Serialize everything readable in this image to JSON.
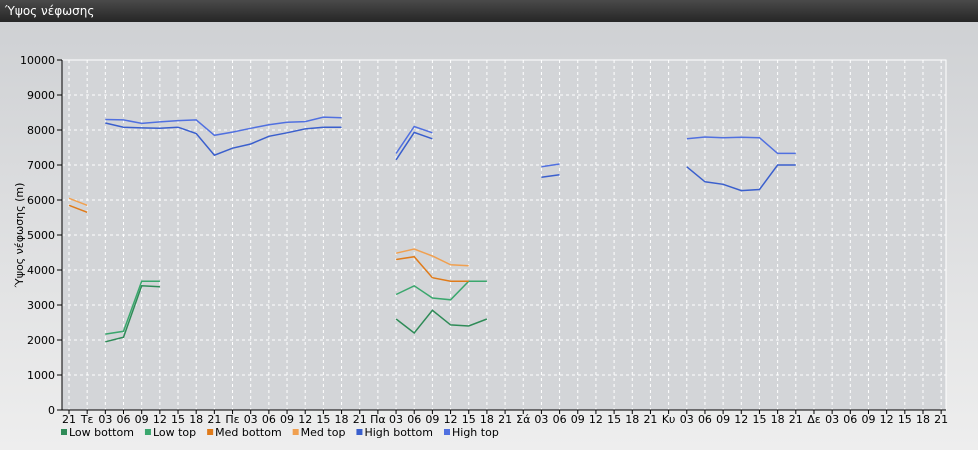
{
  "window": {
    "title": "Ύψος νέφωσης"
  },
  "chart_data": {
    "type": "line",
    "title": "",
    "ylabel": "Ύψος νέφωσης (m)",
    "xlabel": "",
    "ylim": [
      0,
      10000
    ],
    "yticks": [
      0,
      1000,
      2000,
      3000,
      4000,
      5000,
      6000,
      7000,
      8000,
      9000,
      10000
    ],
    "x_tick_labels": [
      "21",
      "Τε",
      "03",
      "06",
      "09",
      "12",
      "15",
      "18",
      "21",
      "Πε",
      "03",
      "06",
      "09",
      "12",
      "15",
      "18",
      "21",
      "Πα",
      "03",
      "06",
      "09",
      "12",
      "15",
      "18",
      "21",
      "Σά",
      "03",
      "06",
      "09",
      "12",
      "15",
      "18",
      "21",
      "Κυ",
      "03",
      "06",
      "09",
      "12",
      "15",
      "18",
      "21",
      "Δε",
      "03",
      "06",
      "09",
      "12",
      "15",
      "18",
      "21"
    ],
    "grid": true,
    "legend": "bottom-left",
    "series": [
      {
        "name": "Low bottom",
        "color": "#2e8b57",
        "segments": [
          [
            [
              2,
              1950
            ],
            [
              3,
              2080
            ],
            [
              4,
              3550
            ],
            [
              5,
              3520
            ]
          ],
          [
            [
              18,
              2600
            ],
            [
              19,
              2200
            ],
            [
              20,
              2850
            ],
            [
              21,
              2430
            ],
            [
              22,
              2400
            ],
            [
              23,
              2600
            ]
          ]
        ]
      },
      {
        "name": "Low top",
        "color": "#3aa76d",
        "segments": [
          [
            [
              2,
              2170
            ],
            [
              3,
              2250
            ],
            [
              4,
              3680
            ],
            [
              5,
              3680
            ]
          ],
          [
            [
              18,
              3300
            ],
            [
              19,
              3550
            ],
            [
              20,
              3200
            ],
            [
              21,
              3150
            ],
            [
              22,
              3680
            ],
            [
              23,
              3680
            ]
          ]
        ]
      },
      {
        "name": "Med bottom",
        "color": "#e07b1a",
        "segments": [
          [
            [
              0,
              5850
            ],
            [
              1,
              5650
            ]
          ],
          [
            [
              18,
              4300
            ],
            [
              19,
              4380
            ],
            [
              20,
              3780
            ],
            [
              21,
              3680
            ],
            [
              22,
              3680
            ]
          ]
        ]
      },
      {
        "name": "Med top",
        "color": "#f0a050",
        "segments": [
          [
            [
              0,
              6050
            ],
            [
              1,
              5850
            ]
          ],
          [
            [
              18,
              4480
            ],
            [
              19,
              4600
            ],
            [
              20,
              4400
            ],
            [
              21,
              4150
            ],
            [
              22,
              4120
            ]
          ]
        ]
      },
      {
        "name": "High bottom",
        "color": "#3a5fcd",
        "segments": [
          [
            [
              2,
              8200
            ],
            [
              3,
              8080
            ],
            [
              4,
              8060
            ],
            [
              5,
              8050
            ],
            [
              6,
              8080
            ],
            [
              7,
              7900
            ],
            [
              8,
              7280
            ],
            [
              9,
              7480
            ],
            [
              10,
              7600
            ],
            [
              11,
              7820
            ],
            [
              12,
              7920
            ],
            [
              13,
              8030
            ],
            [
              14,
              8080
            ],
            [
              15,
              8080
            ]
          ],
          [
            [
              18,
              7150
            ],
            [
              19,
              7930
            ],
            [
              20,
              7750
            ]
          ],
          [
            [
              26,
              6650
            ],
            [
              27,
              6720
            ]
          ],
          [
            [
              34,
              6950
            ],
            [
              35,
              6520
            ],
            [
              36,
              6450
            ],
            [
              37,
              6270
            ],
            [
              38,
              6300
            ],
            [
              39,
              7000
            ],
            [
              40,
              7000
            ]
          ]
        ]
      },
      {
        "name": "High top",
        "color": "#5070e0",
        "segments": [
          [
            [
              2,
              8300
            ],
            [
              3,
              8290
            ],
            [
              4,
              8190
            ],
            [
              5,
              8230
            ],
            [
              6,
              8270
            ],
            [
              7,
              8290
            ],
            [
              8,
              7850
            ],
            [
              9,
              7940
            ],
            [
              10,
              8050
            ],
            [
              11,
              8150
            ],
            [
              12,
              8220
            ],
            [
              13,
              8240
            ],
            [
              14,
              8370
            ],
            [
              15,
              8350
            ]
          ],
          [
            [
              18,
              7330
            ],
            [
              19,
              8100
            ],
            [
              20,
              7920
            ]
          ],
          [
            [
              26,
              6950
            ],
            [
              27,
              7030
            ]
          ],
          [
            [
              34,
              7750
            ],
            [
              35,
              7800
            ],
            [
              36,
              7780
            ],
            [
              37,
              7790
            ],
            [
              38,
              7780
            ],
            [
              39,
              7330
            ],
            [
              40,
              7330
            ]
          ]
        ]
      }
    ]
  }
}
